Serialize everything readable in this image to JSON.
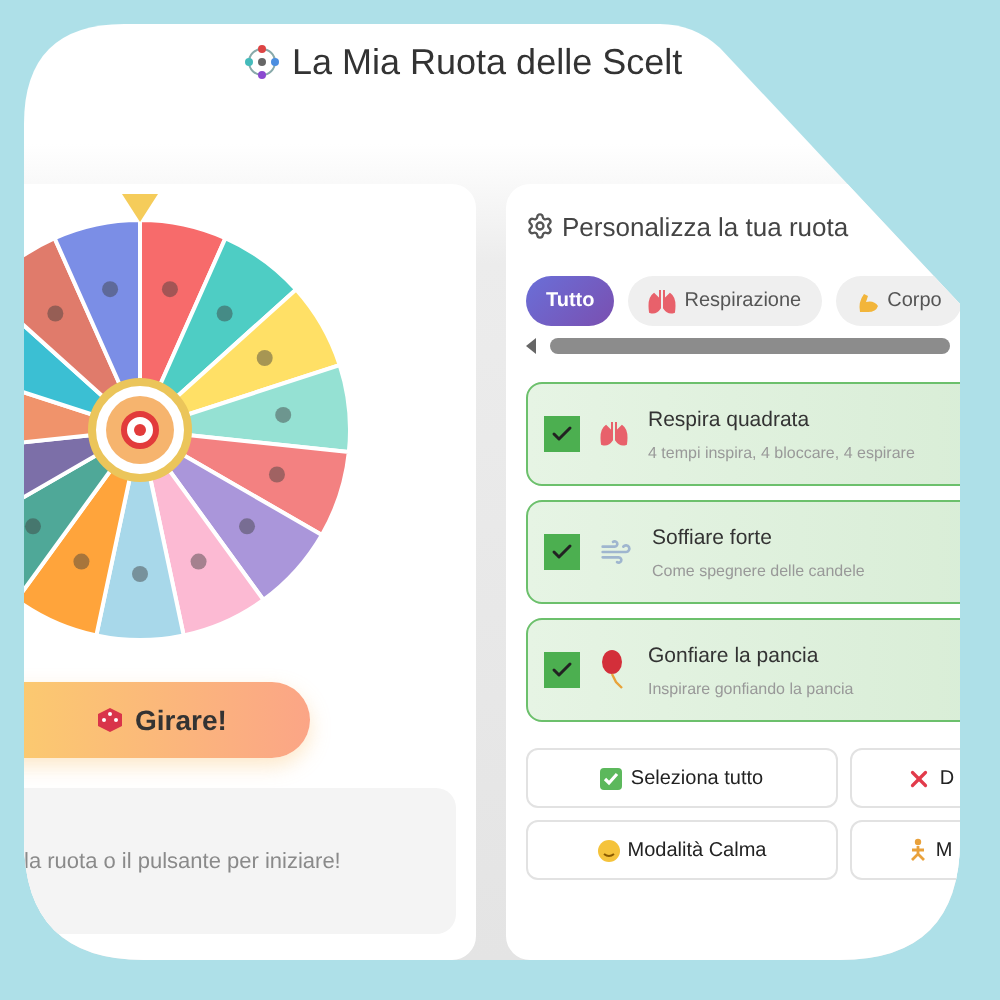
{
  "title": "La Mia Ruota delle Scelt",
  "spin_button": {
    "label": "Girare!"
  },
  "message": "la ruota o il pulsante per iniziare!",
  "panel": {
    "title": "Personalizza la tua ruota",
    "filters": [
      {
        "label": "Tutto",
        "selected": true
      },
      {
        "label": "Respirazione",
        "selected": false
      },
      {
        "label": "Corpo",
        "selected": false
      }
    ],
    "activities": [
      {
        "title": "Respira quadrata",
        "description": "4 tempi inspira, 4 bloccare, 4 espirare",
        "checked": true
      },
      {
        "title": "Soffiare forte",
        "description": "Come spegnere delle candele",
        "checked": true
      },
      {
        "title": "Gonfiare la pancia",
        "description": "Inspirare gonfiando la pancia",
        "checked": true
      }
    ],
    "actions": [
      {
        "label": "Seleziona tutto"
      },
      {
        "label": "D"
      },
      {
        "label": "Modalità Calma"
      },
      {
        "label": "M"
      }
    ]
  }
}
